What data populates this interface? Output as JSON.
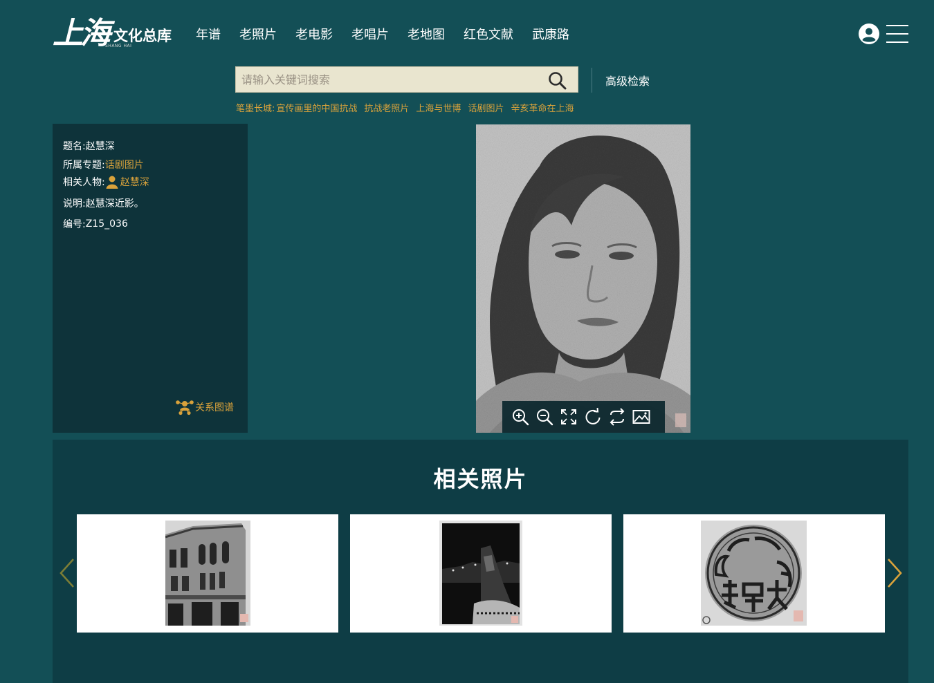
{
  "header": {
    "logo": {
      "calligraphy": "上海",
      "title": "文化总库",
      "subtitle": "SHANG HAI"
    },
    "nav": [
      "年谱",
      "老照片",
      "老电影",
      "老唱片",
      "老地图",
      "红色文献",
      "武康路"
    ],
    "user_icon": "user-circle-icon",
    "menu_icon": "hamburger-menu-icon"
  },
  "search": {
    "placeholder": "请输入关键词搜索",
    "value": "",
    "button_icon": "search-icon",
    "advanced_label": "高级检索"
  },
  "hot_tags": {
    "label": "笔墨长城:",
    "items": [
      "宣传画里的中国抗战",
      "抗战老照片",
      "上海与世博",
      "话剧图片",
      "辛亥革命在上海"
    ]
  },
  "info": {
    "title_label": "题名:",
    "title_value": "赵慧深",
    "topic_label": "所属专题:",
    "topic_value": "话剧图片",
    "person_label": "相关人物:",
    "person_value": "赵慧深",
    "desc_label": "说明:",
    "desc_value": "赵慧深近影。",
    "id_label": "编号:",
    "id_value": "Z15_036",
    "graph_label": "关系图谱"
  },
  "viewer": {
    "tools": [
      "zoom-in-icon",
      "zoom-out-icon",
      "fullscreen-icon",
      "rotate-icon",
      "flip-icon",
      "image-icon"
    ]
  },
  "related": {
    "title": "相关照片",
    "items": [
      {
        "thumb": "building-photo"
      },
      {
        "thumb": "night-city-photo"
      },
      {
        "thumb": "seal-photo"
      }
    ],
    "prev_icon": "chevron-left-icon",
    "next_icon": "chevron-right-icon"
  },
  "colors": {
    "background": "#134f56",
    "panel": "#0e333a",
    "accent": "#d9a23b",
    "search_bg": "#e9e5cf"
  }
}
